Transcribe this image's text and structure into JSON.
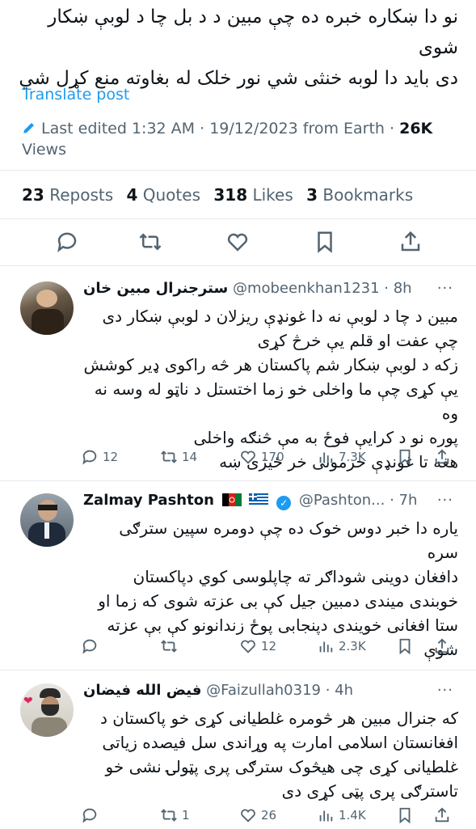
{
  "tweet": {
    "text_line1": "نو دا ښکاره خبره ده چې مبین د د بل چا د لوبې ښکار شوی",
    "text_line2": "دی باید دا لوبه خنثی شي نور خلک له بغاوته منع کړل شي",
    "translate": "Translate post",
    "edited_label": "Last edited",
    "time": "1:32 AM",
    "date": "19/12/2023",
    "source": "from Earth",
    "views_count": "26K",
    "views_label": "Views",
    "reposts_count": "23",
    "reposts_label": "Reposts",
    "quotes_count": "4",
    "quotes_label": "Quotes",
    "likes_count": "318",
    "likes_label": "Likes",
    "bookmarks_count": "3",
    "bookmarks_label": "Bookmarks"
  },
  "replies": [
    {
      "name": "سترجنرال مبین خان",
      "handle": "@mobeenkhan1231",
      "time": "8h",
      "more": "···",
      "lines": [
        "مبین د چا د لوبې نه دا غونډې ریزلان د لوبې ښکار دی",
        "چې عفت او قلم یې خرڅ کړی",
        "زکه د لوبې ښکار شم پاکستان هر څه راکوی ډیر کوشش",
        "یې کړی چې ما واخلی خو زما اختستل د ناټو له وسه نه وه",
        "پوره نو د کرایې فوځ به مې څنګه واخلی",
        "هغه تا غونډې حرمونی خر ځیژی ښه"
      ],
      "replies": "12",
      "reposts": "14",
      "likes": "170",
      "views": "7.3K"
    },
    {
      "name": "Zalmay Pashton",
      "handle": "@Pashton...",
      "time": "7h",
      "more": "···",
      "lines": [
        "یاره دا خبر دوس خوک ده چې دومره سپین سترګی سره",
        "دافغان دوینی شوداګر ته چاپلوسی کوي  دپاکستان",
        "خوبندی میندی دمبین جیل کې بی عزته شوی که زما او",
        "ستا افغانی خویندی  دپنجابی پوځ زندانونو کې بې عزته",
        "شوې"
      ],
      "replies": "",
      "reposts": "",
      "likes": "12",
      "views": "2.3K"
    },
    {
      "name": "فیض الله فیضان",
      "handle": "@Faizullah0319",
      "time": "4h",
      "more": "···",
      "lines": [
        "که جنرال مبین هر څومره غلطیانی کړی  خو پاکستان د",
        "افغانستان اسلامی امارت په وړاندی سل فیصده زیاتی",
        "غلطیانی کړی  چی هیڅوک سترګی پری پټولۍ نشی  خو",
        "تاسترګی پری پټی کړی دی"
      ],
      "replies": "",
      "reposts": "1",
      "likes": "26",
      "views": "1.4K"
    }
  ],
  "icons": {
    "edit": "pencil-icon",
    "reply": "comment-icon",
    "repost": "repost-icon",
    "like": "heart-icon",
    "bookmark": "bookmark-icon",
    "share": "share-icon",
    "views": "bar-chart-icon",
    "verified": "verified-badge-icon"
  },
  "colors": {
    "accent": "#1d9bf0",
    "muted": "#536471",
    "text": "#0f1419"
  }
}
